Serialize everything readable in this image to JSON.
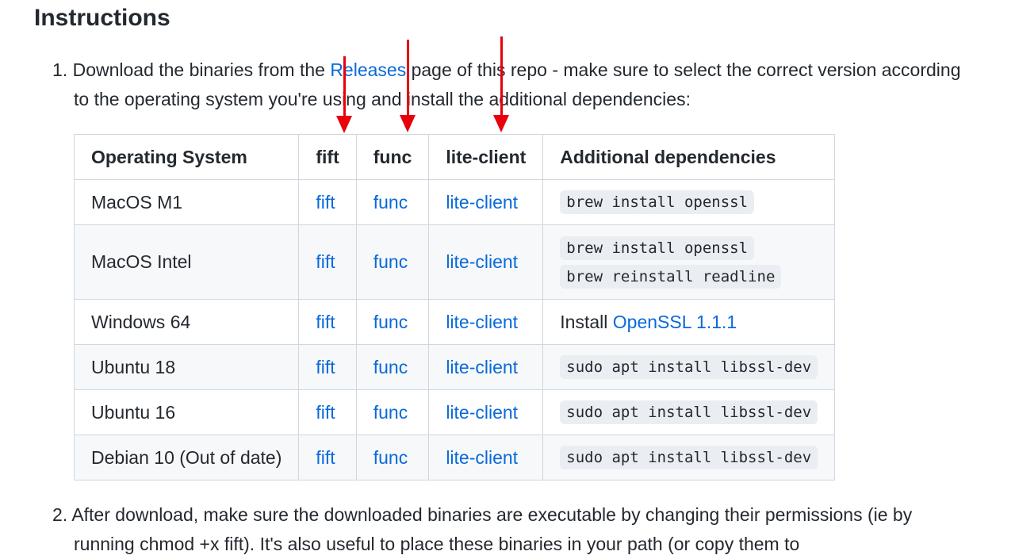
{
  "heading": "Instructions",
  "step1": {
    "number": "1.",
    "pre": "Download the binaries from the ",
    "link": "Releases",
    "post": " page of this repo - make sure to select the correct version according",
    "line2": "to the operating system you're using and install the additional dependencies:"
  },
  "table": {
    "headers": [
      "Operating System",
      "fift",
      "func",
      "lite-client",
      "Additional dependencies"
    ],
    "rows": [
      {
        "os": "MacOS M1",
        "fift": "fift",
        "func": "func",
        "lite": "lite-client",
        "deps": [
          "brew install openssl"
        ]
      },
      {
        "os": "MacOS Intel",
        "fift": "fift",
        "func": "func",
        "lite": "lite-client",
        "deps": [
          "brew install openssl",
          "brew reinstall readline"
        ]
      },
      {
        "os": "Windows 64",
        "fift": "fift",
        "func": "func",
        "lite": "lite-client",
        "deps_text": "Install ",
        "deps_link": "OpenSSL 1.1.1"
      },
      {
        "os": "Ubuntu 18",
        "fift": "fift",
        "func": "func",
        "lite": "lite-client",
        "deps": [
          "sudo apt install libssl-dev"
        ]
      },
      {
        "os": "Ubuntu 16",
        "fift": "fift",
        "func": "func",
        "lite": "lite-client",
        "deps": [
          "sudo apt install libssl-dev"
        ]
      },
      {
        "os": "Debian 10 (Out of date)",
        "fift": "fift",
        "func": "func",
        "lite": "lite-client",
        "deps": [
          "sudo apt install libssl-dev"
        ]
      }
    ]
  },
  "step2": {
    "number": "2.",
    "text": "After download, make sure the downloaded binaries are executable by changing their permissions (ie by",
    "line2": "running chmod +x fift). It's also useful to place these binaries in your path (or copy them to"
  },
  "colors": {
    "arrow": "#e8000b",
    "link": "#0969da"
  }
}
